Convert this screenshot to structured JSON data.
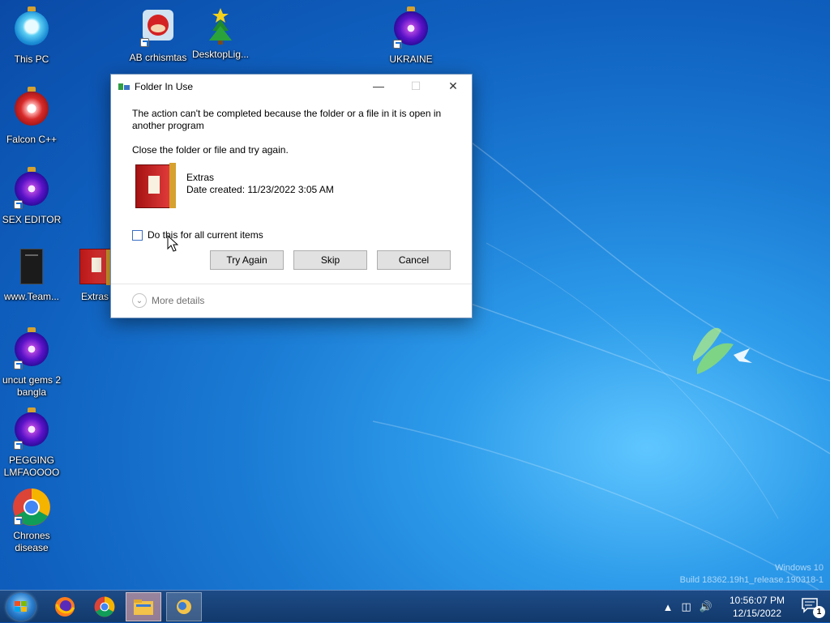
{
  "desktop": {
    "icons": [
      {
        "label": "This PC"
      },
      {
        "label": "AB crhismtas"
      },
      {
        "label": "DesktopLig..."
      },
      {
        "label": "UKRAINE"
      },
      {
        "label": "Falcon C++"
      },
      {
        "label": "SEX EDITOR"
      },
      {
        "label": "www.Team..."
      },
      {
        "label": "Extras"
      },
      {
        "label": "uncut gems 2 bangla"
      },
      {
        "label": "PEGGING LMFAOOOO"
      },
      {
        "label": "Chrones disease"
      }
    ],
    "watermark": {
      "line1": "Windows 10",
      "line2": "Build 18362.19h1_release.190318-1"
    }
  },
  "dialog": {
    "title": "Folder In Use",
    "message": "The action can't be completed because the folder or a file in it is open in another program",
    "instruction": "Close the folder or file and try again.",
    "file_name": "Extras",
    "file_date": "Date created: 11/23/2022 3:05 AM",
    "checkbox_label": "Do this for all current items",
    "checkbox_checked": false,
    "buttons": {
      "try_again": "Try Again",
      "skip": "Skip",
      "cancel": "Cancel"
    },
    "more_details": "More details",
    "icons": {
      "minimize": "minimize-icon",
      "maximize": "maximize-icon",
      "close": "close-icon"
    }
  },
  "taskbar": {
    "items": [
      "start",
      "firefox",
      "chrome",
      "file-explorer",
      "folder-in-use-dialog"
    ],
    "clock_time": "10:56:07 PM",
    "clock_date": "12/15/2022",
    "notification_count": "1"
  },
  "colors": {
    "wallpaper": "#1a7ad3",
    "taskbar": "#12396b",
    "button": "#e1e1e1",
    "checkbox_border": "#3b6fc4"
  }
}
